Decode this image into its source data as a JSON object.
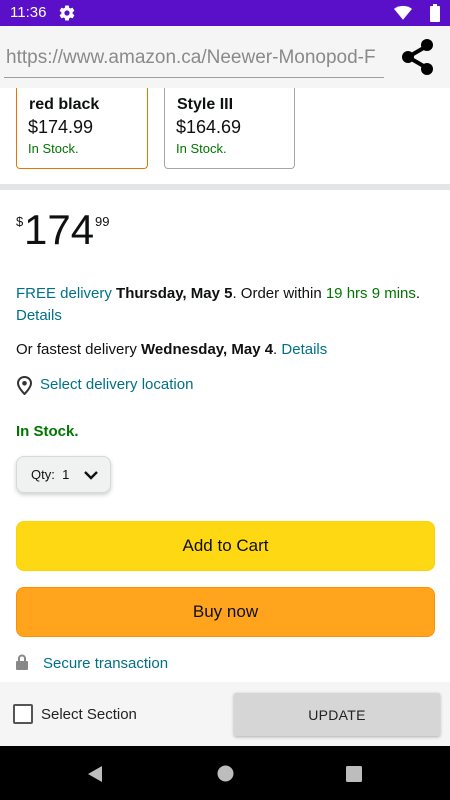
{
  "status_bar": {
    "time": "11:36"
  },
  "browser": {
    "url": "https://www.amazon.ca/Neewer-Monopod-F"
  },
  "variants": [
    {
      "name": "red black",
      "price": "$174.99",
      "stock": "In Stock.",
      "selected": true
    },
    {
      "name": "Style III",
      "price": "$164.69",
      "stock": "In Stock.",
      "selected": false
    }
  ],
  "price": {
    "symbol": "$",
    "whole": "174",
    "fraction": "99"
  },
  "delivery": {
    "free_label": "FREE delivery",
    "date": "Thursday, May 5",
    "order_within_prefix": ". Order within ",
    "countdown": "19 hrs 9 mins",
    "suffix": ". ",
    "details": "Details"
  },
  "fastest": {
    "prefix": "Or fastest delivery ",
    "date": "Wednesday, May 4",
    "suffix": ". ",
    "details": "Details"
  },
  "location": {
    "label": "Select delivery location"
  },
  "stock_status": "In Stock.",
  "quantity": {
    "label": "Qty:",
    "value": "1"
  },
  "buttons": {
    "add_to_cart": "Add to Cart",
    "buy_now": "Buy now"
  },
  "secure": "Secure transaction",
  "bottom": {
    "checkbox_label": "Select Section",
    "update": "UPDATE"
  },
  "colors": {
    "status_bar": "#5a0fc8",
    "link": "#007185",
    "stock_green": "#007600",
    "add_to_cart": "#ffd814",
    "buy_now": "#ffa41c"
  }
}
